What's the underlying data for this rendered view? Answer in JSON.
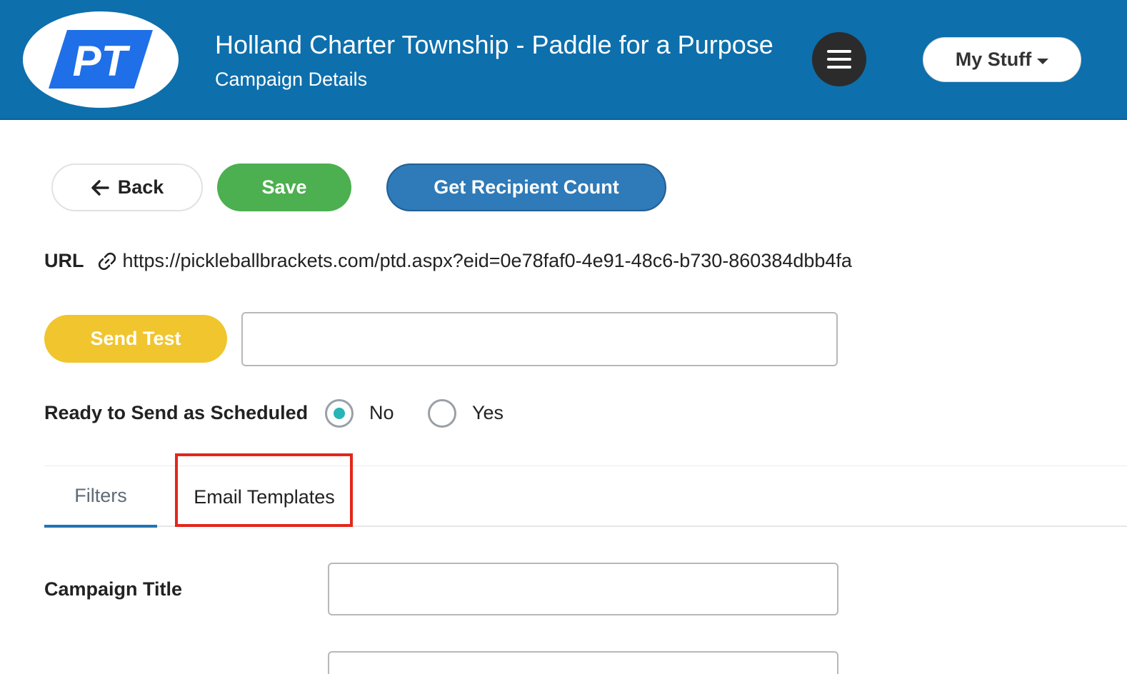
{
  "header": {
    "logo_text": "PT",
    "title": "Holland Charter Township - Paddle for a Purpose",
    "subtitle": "Campaign Details",
    "menu_icon": "hamburger-icon",
    "my_stuff_label": "My Stuff",
    "colors": {
      "background": "#0d6fac",
      "logo_blue": "#1f6fe8"
    }
  },
  "toolbar": {
    "back_label": "Back",
    "save_label": "Save",
    "recipient_label": "Get Recipient Count"
  },
  "url": {
    "label": "URL",
    "value": "https://pickleballbrackets.com/ptd.aspx?eid=0e78faf0-4e91-48c6-b730-860384dbb4fa"
  },
  "send_test": {
    "label": "Send Test",
    "value": ""
  },
  "ready": {
    "label": "Ready to Send as Scheduled",
    "options": [
      {
        "label": "No",
        "selected": true
      },
      {
        "label": "Yes",
        "selected": false
      }
    ]
  },
  "tabs": [
    {
      "label": "Filters",
      "active": true
    },
    {
      "label": "Email Templates",
      "active": false,
      "highlighted": true
    }
  ],
  "form": {
    "campaign_title_label": "Campaign Title",
    "campaign_title_value": "",
    "second_field_value": ""
  },
  "colors": {
    "save": "#4caf50",
    "recipient": "#2f7ab8",
    "send_test": "#f0c52e",
    "radio_selected": "#27b5b5",
    "tab_active_underline": "#1f75b5",
    "highlight_box": "#e4261b"
  }
}
